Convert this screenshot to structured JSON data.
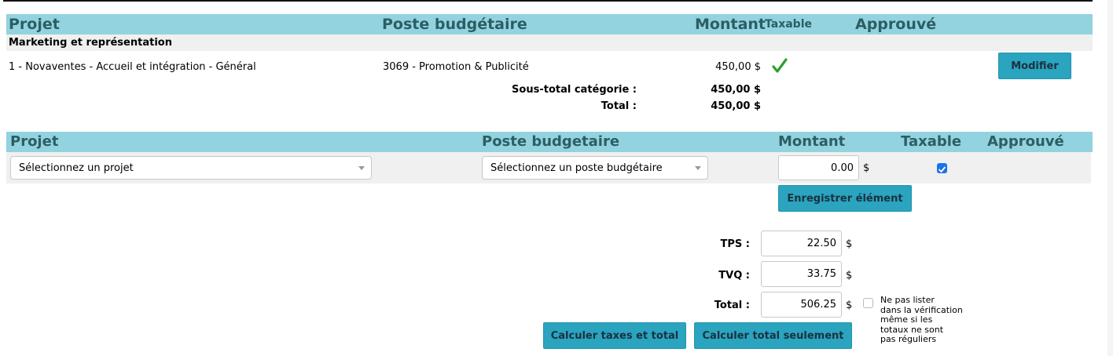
{
  "table1": {
    "headers": {
      "projet": "Projet",
      "poste": "Poste budgétaire",
      "montant": "Montant",
      "taxable": "Taxable",
      "approuve": "Approuvé"
    },
    "category": "Marketing et représentation",
    "rows": [
      {
        "projet": "1 - Novaventes - Accueil et intégration - Général",
        "poste": "3069 - Promotion & Publicité",
        "montant": "450,00 $",
        "taxable": true,
        "action_label": "Modifier"
      }
    ],
    "subtotal_label": "Sous-total catégorie :",
    "subtotal_value": "450,00 $",
    "total_label": "Total :",
    "total_value": "450,00 $"
  },
  "form": {
    "headers": {
      "projet": "Projet",
      "poste": "Poste budgetaire",
      "montant": "Montant",
      "taxable": "Taxable",
      "approuve": "Approuvé"
    },
    "project_select": "Sélectionnez un projet",
    "poste_select": "Sélectionnez un poste budgétaire",
    "montant_value": "0.00",
    "currency": "$",
    "taxable_checked": true,
    "save_label": "Enregistrer élément"
  },
  "taxes": {
    "tps_label": "TPS :",
    "tps_value": "22.50",
    "tvq_label": "TVQ :",
    "tvq_value": "33.75",
    "total_label": "Total :",
    "total_value": "506.25",
    "currency": "$",
    "note": [
      "Ne pas lister",
      "dans la vérification",
      "même si les",
      "totaux ne sont",
      "pas réguliers"
    ],
    "calc_taxes_label": "Calculer taxes et total",
    "calc_total_label": "Calculer total seulement"
  },
  "colors": {
    "header_bg": "#93d3e0",
    "header_text": "#2b5e63",
    "button": "#2aa4bf",
    "check": "#2e9e2e"
  }
}
